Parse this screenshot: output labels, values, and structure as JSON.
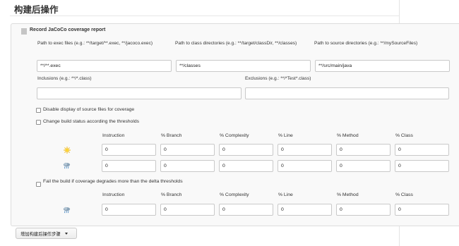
{
  "section": {
    "title": "构建后操作",
    "add_step_label": "增加构建后操作步骤"
  },
  "jacoco": {
    "title": "Record JaCoCo coverage report",
    "exec_label": "Path to exec files (e.g.: **/target/**.exec, **/jacoco.exec)",
    "exec_value": "**/**.exec",
    "class_dir_label": "Path to class directories (e.g.: **/target/classDir, **/classes)",
    "class_dir_value": "**/classes",
    "source_dir_label": "Path to source directories (e.g.: **/mySourceFiles)",
    "source_dir_value": "**/src/main/java",
    "inclusions_label": "Inclusions (e.g.: **/*.class)",
    "inclusions_value": "",
    "exclusions_label": "Exclusions (e.g.: **/*Test*.class)",
    "exclusions_value": "",
    "disable_source_label": "Disable display of source files for coverage",
    "disable_source_checked": false,
    "change_build_label": "Change build status according the thresholds",
    "change_build_checked": false,
    "fail_build_label": "Fail the build if coverage degrades more than the delta thresholds",
    "fail_build_checked": false,
    "columns": [
      "Instruction",
      "% Branch",
      "% Complexity",
      "% Line",
      "% Method",
      "% Class"
    ],
    "thresholds": {
      "healthy": {
        "icon": "sunny-icon",
        "values": [
          "0",
          "0",
          "0",
          "0",
          "0",
          "0"
        ]
      },
      "unhealthy": {
        "icon": "stormy-icon",
        "values": [
          "0",
          "0",
          "0",
          "0",
          "0",
          "0"
        ]
      }
    },
    "delta": {
      "icon": "stormy-icon",
      "values": [
        "0",
        "0",
        "0",
        "0",
        "0",
        "0"
      ]
    }
  }
}
